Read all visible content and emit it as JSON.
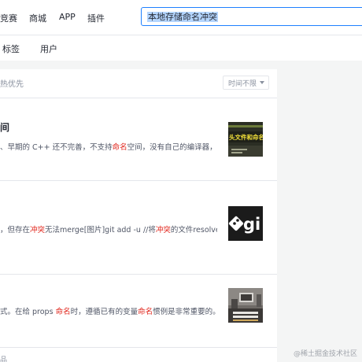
{
  "nav": {
    "items": [
      "竞赛",
      "商城",
      "APP",
      "插件"
    ]
  },
  "search": {
    "value": "本地存储命名冲突"
  },
  "subnav": {
    "tabs": [
      "标签",
      "用户"
    ]
  },
  "filter": {
    "sort_label": "热优先",
    "time_select": "时间不限"
  },
  "results": [
    {
      "title": "间",
      "snippet": [
        {
          "t": "、早期的 C++ 还不完善，不支持",
          "h": false
        },
        {
          "t": "命名",
          "h": true
        },
        {
          "t": "空间，没有自己的编译器，而且",
          "h": false
        }
      ],
      "thumb_text": "头文件和命名空"
    },
    {
      "title": "",
      "snippet": [
        {
          "t": "，但存在",
          "h": false
        },
        {
          "t": "冲突",
          "h": true
        },
        {
          "t": "无法merge[图片]git add -u //将",
          "h": false
        },
        {
          "t": "冲突",
          "h": true
        },
        {
          "t": "的文件resolve掉之",
          "h": false
        }
      ],
      "thumb_text": "gi"
    },
    {
      "title": "",
      "snippet": [
        {
          "t": "式。在给 props ",
          "h": false
        },
        {
          "t": "命名",
          "h": true
        },
        {
          "t": "时，遵循已有的变量",
          "h": false
        },
        {
          "t": "命名",
          "h": true
        },
        {
          "t": "惯例是非常重要的。例如",
          "h": false
        }
      ],
      "thumb_text": ""
    }
  ],
  "more_text": "品",
  "watermark": "@稀土掘金技术社区",
  "colors": {
    "accent": "#1e80ff",
    "highlight": "#e1251b"
  }
}
